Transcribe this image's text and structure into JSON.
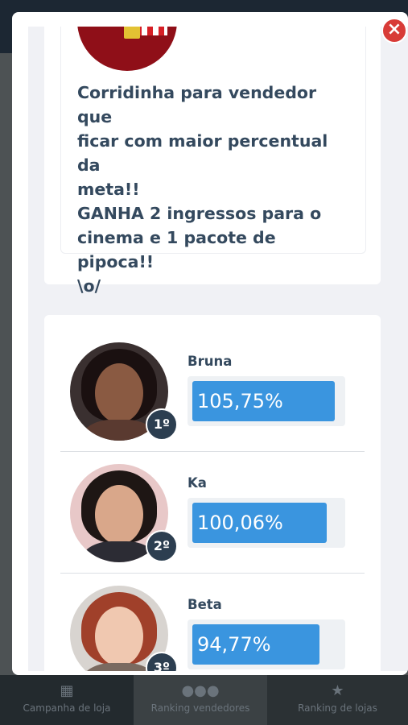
{
  "modal": {
    "close_label": "×",
    "promo_text": "Corridinha para vendedor que\nficar com maior percentual da\nmeta!!\nGANHA 2 ingressos para o\ncinema e 1 pacote de pipoca!!\n\\o/"
  },
  "ranking": [
    {
      "name": "Bruna",
      "percent": "105,75%",
      "position": "1º",
      "fill": 0.96
    },
    {
      "name": "Ka",
      "percent": "100,06%",
      "position": "2º",
      "fill": 0.91
    },
    {
      "name": "Beta",
      "percent": "94,77%",
      "position": "3º",
      "fill": 0.86
    }
  ],
  "bottom_nav": [
    {
      "label": "Campanha de loja",
      "icon": "building-icon"
    },
    {
      "label": "Ranking vendedores",
      "icon": "users-icon"
    },
    {
      "label": "Ranking de lojas",
      "icon": "trophy-icon"
    }
  ],
  "colors": {
    "accent_bar": "#3a95df",
    "badge": "#2c3e50",
    "close": "#d83b37",
    "text": "#34495e"
  }
}
